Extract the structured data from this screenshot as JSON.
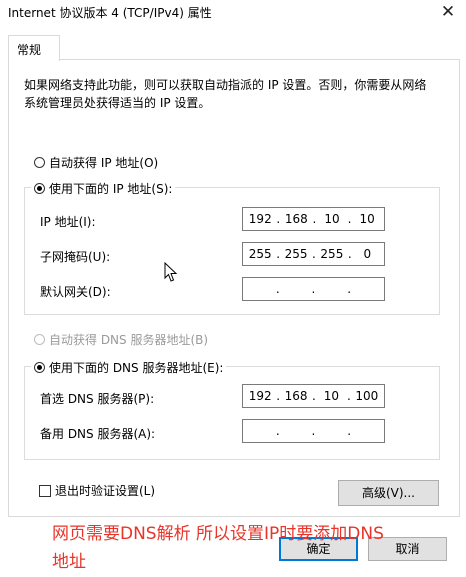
{
  "window": {
    "title": "Internet 协议版本 4 (TCP/IPv4) 属性",
    "close_glyph": "✕"
  },
  "tabs": [
    {
      "label": "常规"
    }
  ],
  "description": "如果网络支持此功能，则可以获取自动指派的 IP 设置。否则，你需要从网络系统管理员处获得适当的 IP 设置。",
  "ip_mode": {
    "auto_label": "自动获得 IP 地址(O)",
    "manual_label": "使用下面的 IP 地址(S):",
    "selected": "manual"
  },
  "ip_fields": [
    {
      "label": "IP 地址(I):",
      "octets": [
        "192",
        "168",
        "10",
        "10"
      ]
    },
    {
      "label": "子网掩码(U):",
      "octets": [
        "255",
        "255",
        "255",
        "0"
      ]
    },
    {
      "label": "默认网关(D):",
      "octets": [
        "",
        "",
        "",
        ""
      ]
    }
  ],
  "dns_mode": {
    "auto_label": "自动获得 DNS 服务器地址(B)",
    "manual_label": "使用下面的 DNS 服务器地址(E):",
    "selected": "manual",
    "auto_disabled": true
  },
  "dns_fields": [
    {
      "label": "首选 DNS 服务器(P):",
      "octets": [
        "192",
        "168",
        "10",
        "100"
      ]
    },
    {
      "label": "备用 DNS 服务器(A):",
      "octets": [
        "",
        "",
        "",
        ""
      ]
    }
  ],
  "validate_checkbox": {
    "label": "退出时验证设置(L)",
    "checked": false
  },
  "buttons": {
    "advanced": "高级(V)...",
    "ok": "确定",
    "cancel": "取消"
  },
  "annotation": {
    "line1": "网页需要DNS解析 所以设置IP时要添加DNS",
    "line2": "地址",
    "color": "#e8342a"
  },
  "icons": {
    "close": "close-icon",
    "cursor": "mouse-pointer-icon"
  }
}
